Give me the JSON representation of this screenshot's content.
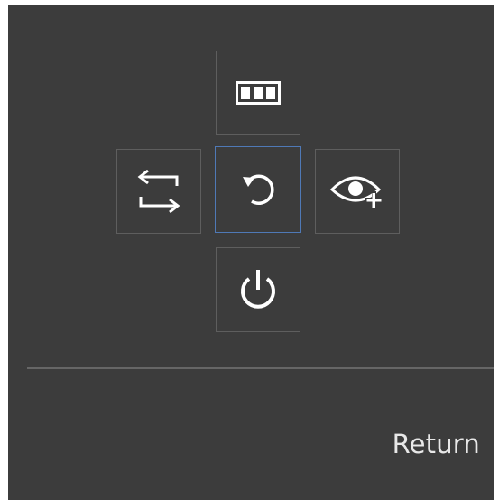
{
  "colors": {
    "panel_background": "#3c3c3c",
    "button_border": "#5e5e5e",
    "selected_border": "#4f79b6",
    "icon_color": "#ffffff",
    "divider": "#666666",
    "text": "#e8e8e8"
  },
  "menu": {
    "buttons": [
      {
        "position": "top",
        "icon": "picture-columns-icon",
        "selected": false
      },
      {
        "position": "left",
        "icon": "swap-arrows-icon",
        "selected": false
      },
      {
        "position": "center",
        "icon": "rotate-reset-icon",
        "selected": true
      },
      {
        "position": "right",
        "icon": "eye-plus-icon",
        "selected": false
      },
      {
        "position": "bottom",
        "icon": "power-icon",
        "selected": false
      }
    ]
  },
  "footer": {
    "return_label": "Return"
  }
}
